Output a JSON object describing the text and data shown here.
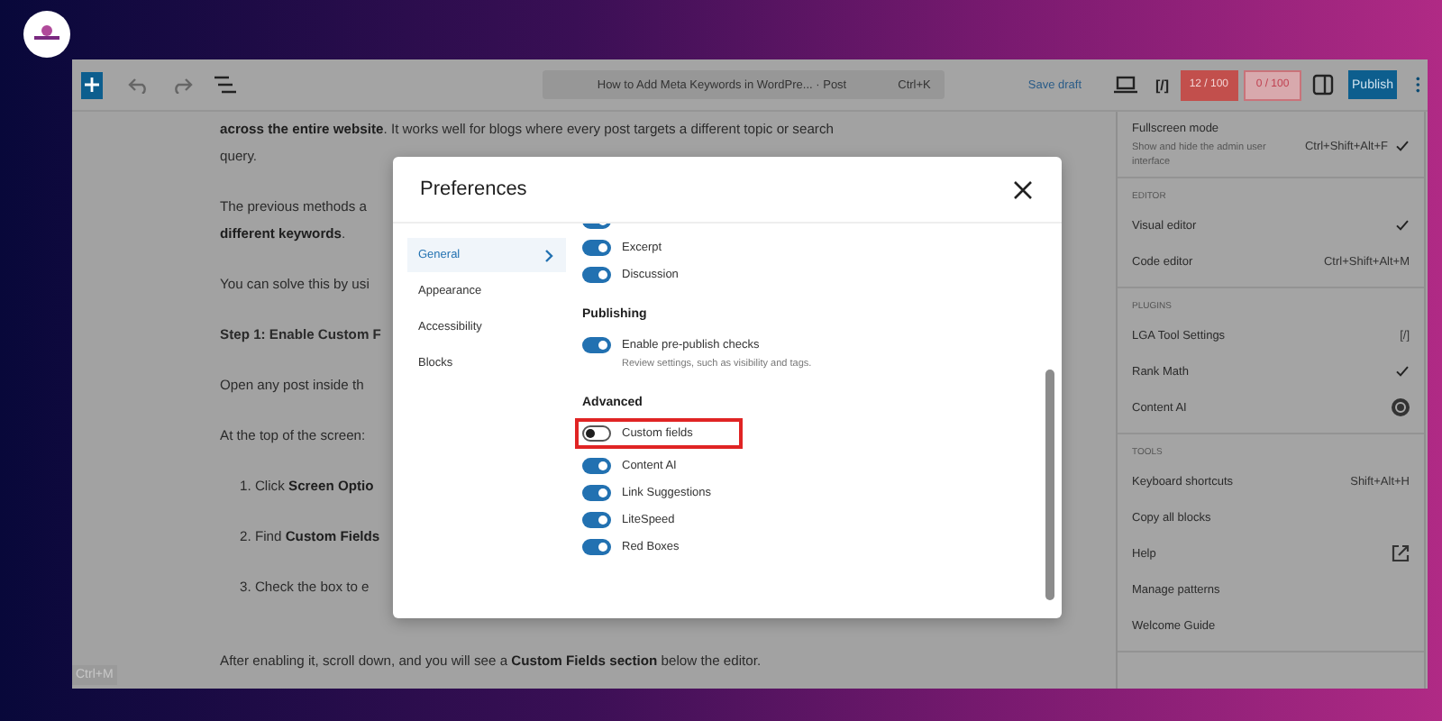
{
  "toolbar": {
    "title": "How to Add Meta Keywords in WordPre... · Post",
    "title_shortcut": "Ctrl+K",
    "save": "Save draft",
    "code_label": "[/]",
    "seo_score": "12 / 100",
    "readability_score": "0 / 100",
    "publish": "Publish"
  },
  "article": [
    {
      "kind": "para",
      "text": "**across the entire website**. It works well for blogs where every post targets a different topic or search"
    },
    {
      "kind": "para",
      "text": "query."
    },
    {
      "kind": "gap"
    },
    {
      "kind": "para",
      "text": "The previous methods a"
    },
    {
      "kind": "para",
      "text": "**different keywords**."
    },
    {
      "kind": "gap"
    },
    {
      "kind": "para",
      "text": "You can solve this by usi"
    },
    {
      "kind": "gap"
    },
    {
      "kind": "heading",
      "text": "Step 1: Enable Custom F"
    },
    {
      "kind": "gap"
    },
    {
      "kind": "para",
      "text": "Open any post inside th"
    },
    {
      "kind": "gap"
    },
    {
      "kind": "para",
      "text": "At the top of the screen:"
    },
    {
      "kind": "gap"
    },
    {
      "kind": "list",
      "text": "1. Click **Screen Optio**"
    },
    {
      "kind": "gap"
    },
    {
      "kind": "list",
      "text": "2. Find **Custom Fields**"
    },
    {
      "kind": "gap"
    },
    {
      "kind": "list",
      "text": "3. Check the box to e"
    },
    {
      "kind": "gap"
    },
    {
      "kind": "gap"
    },
    {
      "kind": "para",
      "text": "After enabling it, scroll down, and you will see a **Custom Fields section** below the editor."
    }
  ],
  "shortcut_hint": "Ctrl+M",
  "menu": {
    "sections": [
      {
        "items": [
          {
            "label": "Fullscreen mode",
            "description": "Show and hide the admin user interface",
            "shortcut": "Ctrl+Shift+Alt+F",
            "checked": true,
            "kind": "text"
          }
        ]
      },
      {
        "heading": "EDITOR",
        "items": [
          {
            "label": "Visual editor",
            "checked": true,
            "kind": "text"
          },
          {
            "label": "Code editor",
            "shortcut": "Ctrl+Shift+Alt+M",
            "checked": false,
            "kind": "text"
          }
        ]
      },
      {
        "heading": "PLUGINS",
        "items": [
          {
            "label": "LGA Tool Settings",
            "shortcut": "[/]",
            "checked": false,
            "kind": "text"
          },
          {
            "label": "Rank Math",
            "checked": true,
            "kind": "text"
          },
          {
            "label": "Content AI",
            "checked": false,
            "kind": "badge"
          }
        ]
      },
      {
        "heading": "TOOLS",
        "items": [
          {
            "label": "Keyboard shortcuts",
            "shortcut": "Shift+Alt+H",
            "checked": false,
            "kind": "text"
          },
          {
            "label": "Copy all blocks",
            "checked": false,
            "kind": "text"
          },
          {
            "label": "Help",
            "checked": false,
            "kind": "external"
          },
          {
            "label": "Manage patterns",
            "checked": false,
            "kind": "text"
          },
          {
            "label": "Welcome Guide",
            "checked": false,
            "kind": "text"
          }
        ]
      }
    ]
  },
  "preferences": {
    "title": "Preferences",
    "nav": [
      {
        "label": "General",
        "selected": true
      },
      {
        "label": "Appearance",
        "selected": false
      },
      {
        "label": "Accessibility",
        "selected": false
      },
      {
        "label": "Blocks",
        "selected": false
      }
    ],
    "groups": [
      {
        "toggles": [
          {
            "on": true,
            "highlighted": false
          },
          {
            "label": "Excerpt",
            "on": true,
            "highlighted": false
          },
          {
            "label": "Discussion",
            "on": true,
            "highlighted": false
          }
        ]
      },
      {
        "heading": "Publishing",
        "toggles": [
          {
            "label": "Enable pre-publish checks",
            "description": "Review settings, such as visibility and tags.",
            "on": true,
            "highlighted": false
          }
        ]
      },
      {
        "heading": "Advanced",
        "toggles": [
          {
            "label": "Custom fields",
            "on": false,
            "highlighted": true
          },
          {
            "label": "Content AI",
            "on": true,
            "highlighted": false
          },
          {
            "label": "Link Suggestions",
            "on": true,
            "highlighted": false
          },
          {
            "label": "LiteSpeed",
            "on": true,
            "highlighted": false
          },
          {
            "label": "Red Boxes",
            "on": true,
            "highlighted": false
          }
        ]
      }
    ]
  }
}
